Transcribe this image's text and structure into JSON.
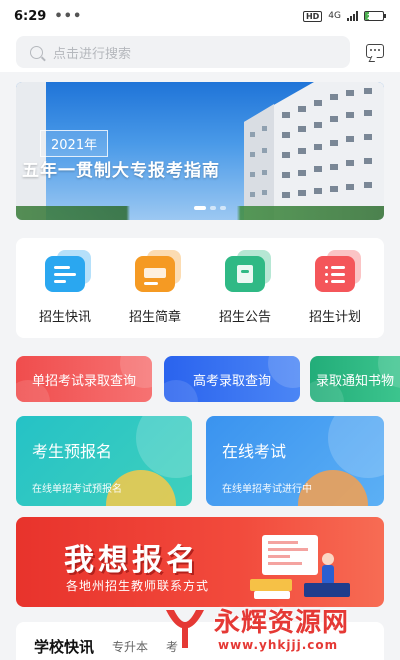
{
  "status_bar": {
    "time": "6:29",
    "dots": "•••",
    "hd": "HD",
    "network": "4G",
    "battery": "23",
    "battery_level": 0.23
  },
  "search": {
    "placeholder": "点击进行搜索",
    "icon": "search-icon"
  },
  "header_icons": {
    "message": "message-icon"
  },
  "banner": {
    "year": "2021年",
    "title": "五年一贯制大专报考指南",
    "slides": 3,
    "active_slide": 1
  },
  "categories": [
    {
      "label": "招生快讯",
      "icon": "news-icon",
      "color": "#2aa7f0"
    },
    {
      "label": "招生简章",
      "icon": "brochure-icon",
      "color": "#f59a23"
    },
    {
      "label": "招生公告",
      "icon": "announcement-icon",
      "color": "#2fb985"
    },
    {
      "label": "招生计划",
      "icon": "plan-icon",
      "color": "#f4565a"
    }
  ],
  "quick_links": [
    {
      "label": "单招考试录取查询",
      "color": "#f25757"
    },
    {
      "label": "高考录取查询",
      "color": "#2f6ff0"
    },
    {
      "label": "录取通知书物",
      "color": "#2fb985"
    }
  ],
  "cards": [
    {
      "title": "考生预报名",
      "subtitle": "在线单招考试预报名",
      "color": "#2bc6c7"
    },
    {
      "title": "在线考试",
      "subtitle": "在线单招考试进行中",
      "color": "#3d9bef"
    }
  ],
  "enroll_banner": {
    "title": "我想报名",
    "subtitle": "各地州招生教师联系方式"
  },
  "news": {
    "heading": "学校快讯",
    "tabs": [
      "专升本",
      "考"
    ]
  },
  "watermark": {
    "text": "永辉资源网",
    "url": "www.yhkjjj.com"
  }
}
